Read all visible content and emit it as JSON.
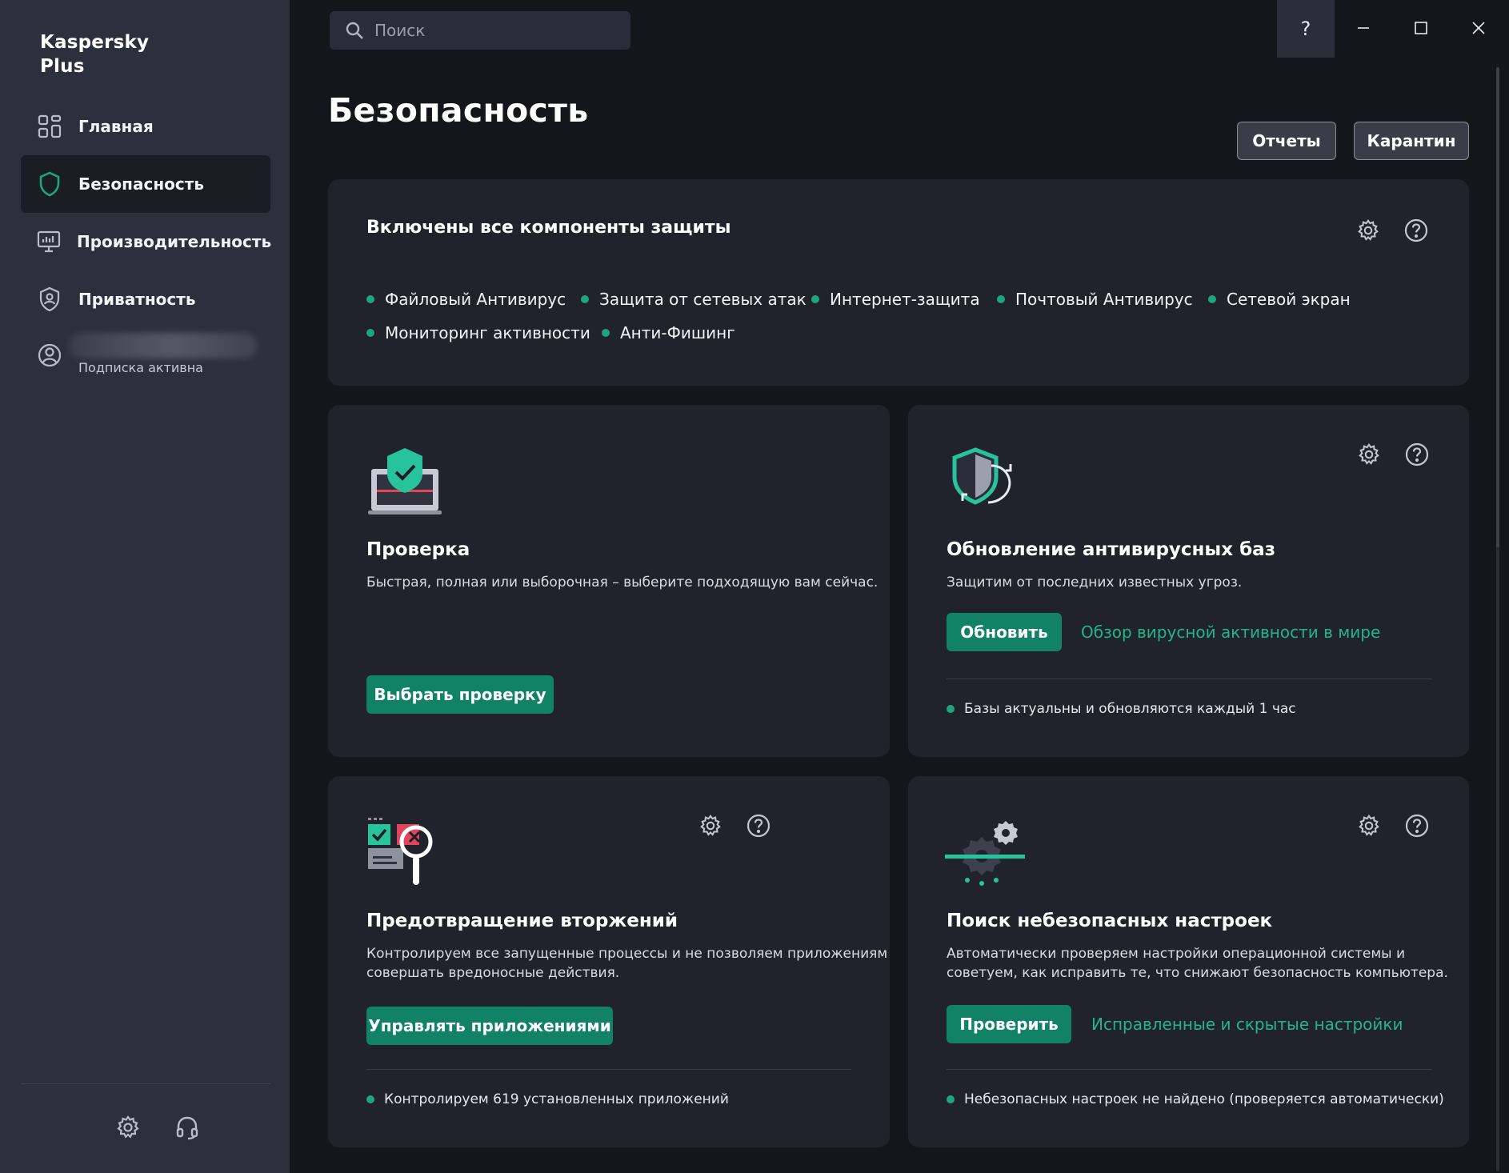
{
  "app": {
    "brand_line1": "Kaspersky",
    "brand_line2": "Plus"
  },
  "sidebar": {
    "items": [
      {
        "label": "Главная",
        "icon": "grid-icon"
      },
      {
        "label": "Безопасность",
        "icon": "shield-icon",
        "active": true
      },
      {
        "label": "Производительность",
        "icon": "monitor-icon"
      },
      {
        "label": "Приватность",
        "icon": "privacy-shield-icon"
      }
    ],
    "account": {
      "subscription": "Подписка активна"
    }
  },
  "search": {
    "placeholder": "Поиск"
  },
  "window": {
    "help": "?"
  },
  "page": {
    "title": "Безопасность",
    "reports": "Отчеты",
    "quarantine": "Карантин"
  },
  "protection": {
    "title": "Включены все компоненты защиты",
    "components": [
      "Файловый Антивирус",
      "Защита от сетевых атак",
      "Интернет-защита",
      "Почтовый Антивирус",
      "Сетевой экран",
      "Мониторинг активности",
      "Анти-Фишинг"
    ]
  },
  "scan": {
    "title": "Проверка",
    "desc": "Быстрая, полная или выборочная – выберите подходящую вам сейчас.",
    "button": "Выбрать проверку"
  },
  "update": {
    "title": "Обновление антивирусных баз",
    "desc": "Защитим от последних известных угроз.",
    "button": "Обновить",
    "link": "Обзор вирусной активности в мире",
    "status": "Базы актуальны и обновляются каждый 1 час"
  },
  "intrusion": {
    "title": "Предотвращение вторжений",
    "desc1": "Контролируем все запущенные процессы и не позволяем приложениям",
    "desc2": "совершать вредоносные действия.",
    "button": "Управлять приложениями",
    "status": "Контролируем 619 установленных приложений"
  },
  "unsafe": {
    "title": "Поиск небезопасных настроек",
    "desc1": "Автоматически проверяем настройки операционной системы и",
    "desc2": "советуем, как исправить те, что снижают безопасность компьютера.",
    "button": "Проверить",
    "link": "Исправленные и скрытые настройки",
    "status": "Небезопасных настроек не найдено (проверяется автоматически)"
  },
  "colors": {
    "accent": "#118266",
    "status_green": "#1ea57e",
    "link": "#23b48a",
    "sidebar": "#2c303d",
    "background": "#15161c",
    "card": "#21232c"
  }
}
